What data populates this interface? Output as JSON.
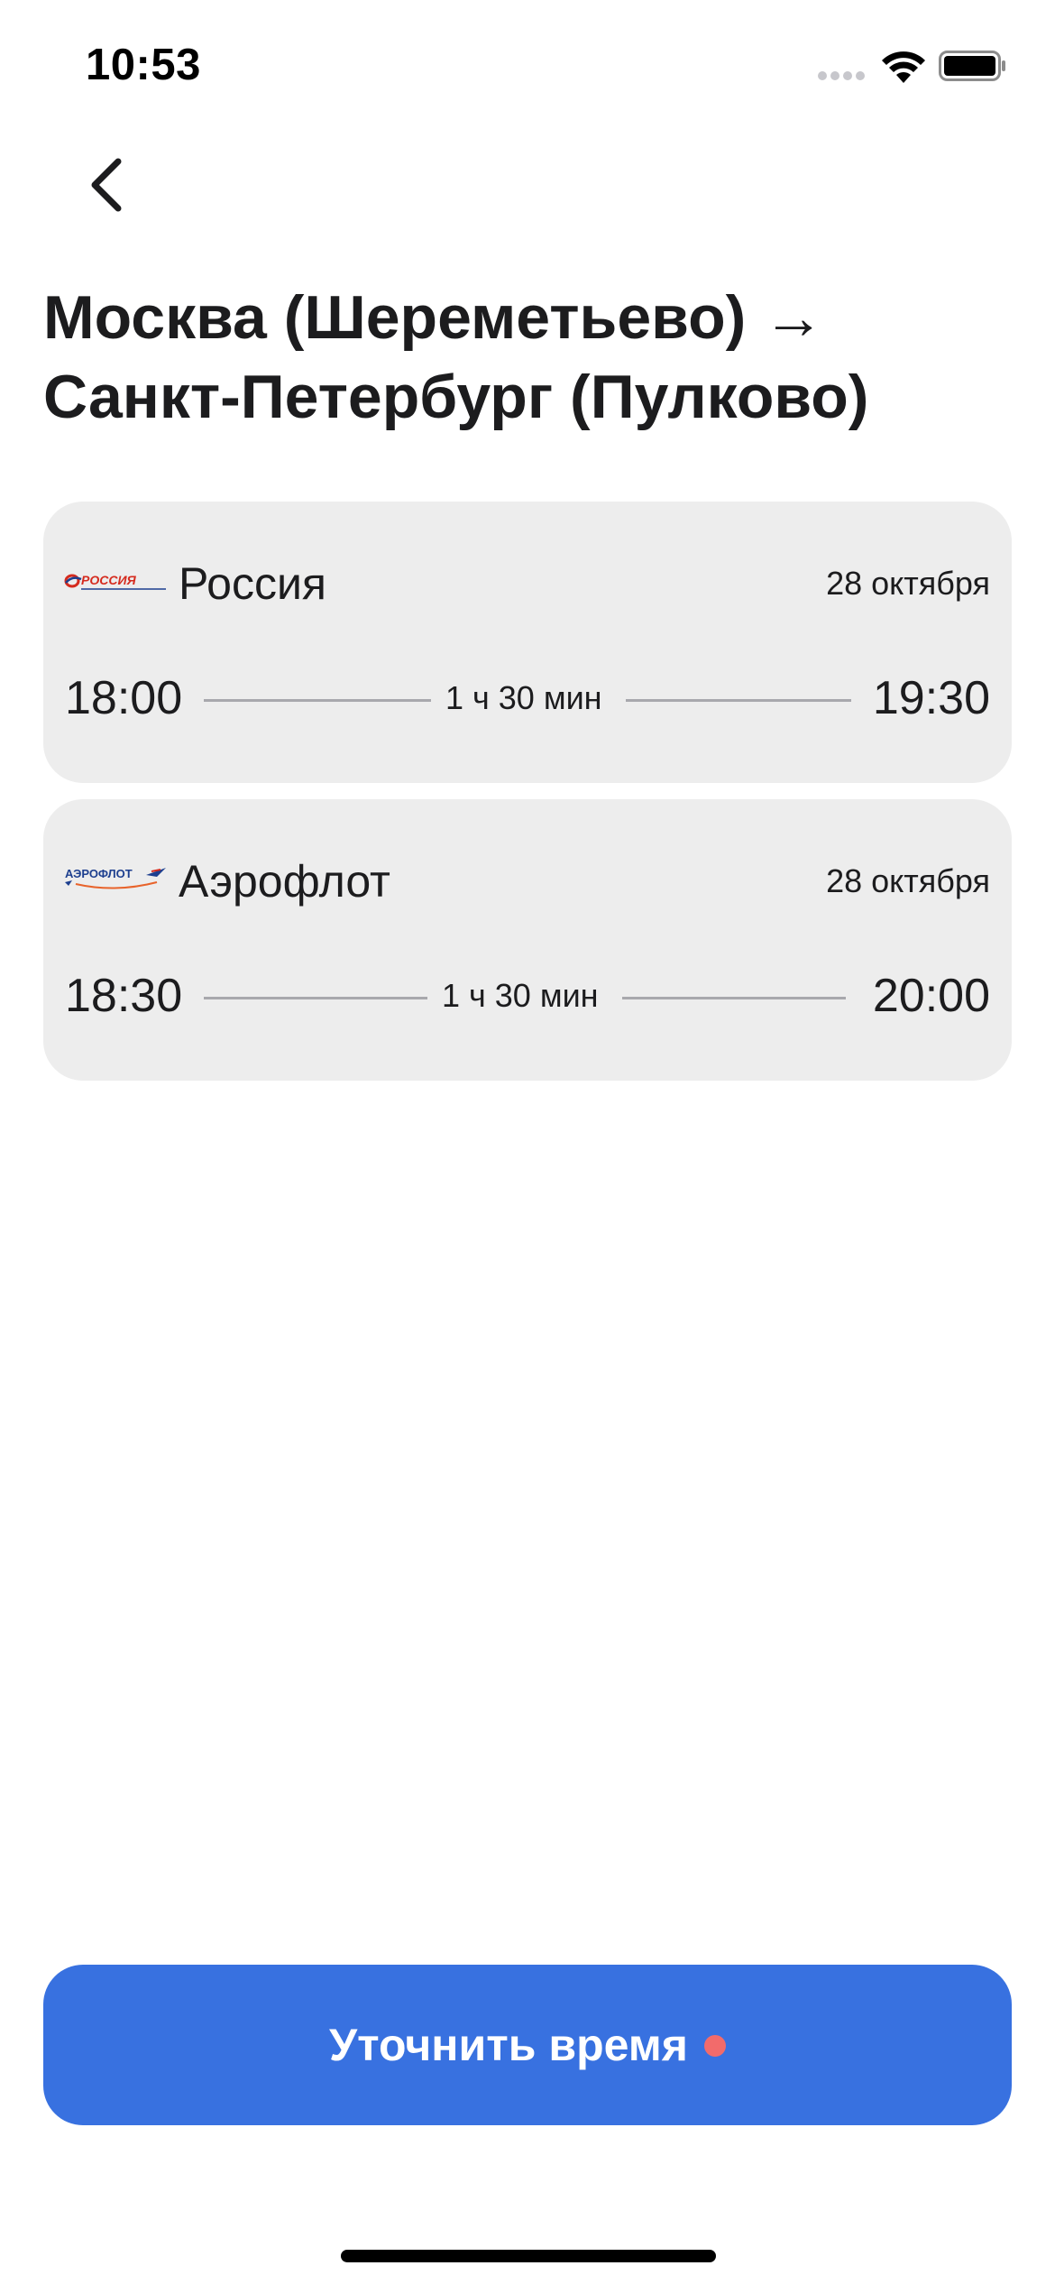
{
  "status_bar": {
    "time": "10:53",
    "icons": [
      "signal-icon",
      "wifi-icon",
      "battery-icon"
    ]
  },
  "header": {
    "back_icon": "chevron-left-icon",
    "title_line1": "Москва (Шереметьево) →",
    "title_line2": "Санкт-Петербург (Пулково)"
  },
  "flights": [
    {
      "airline": "Россия",
      "logo_text": "РОССИЯ",
      "date": "28 октября",
      "departure": "18:00",
      "duration": "1 ч 30 мин",
      "arrival": "19:30"
    },
    {
      "airline": "Аэрофлот",
      "logo_text": "АЭРОФЛОТ",
      "date": "28 октября",
      "departure": "18:30",
      "duration": "1 ч 30 мин",
      "arrival": "20:00"
    }
  ],
  "action": {
    "button_label": "Уточнить время",
    "has_notification_dot": true
  },
  "colors": {
    "accent": "#3871e0",
    "card_background": "#ededed",
    "notification_dot": "#f26b6b",
    "text": "#1c1c1e"
  }
}
